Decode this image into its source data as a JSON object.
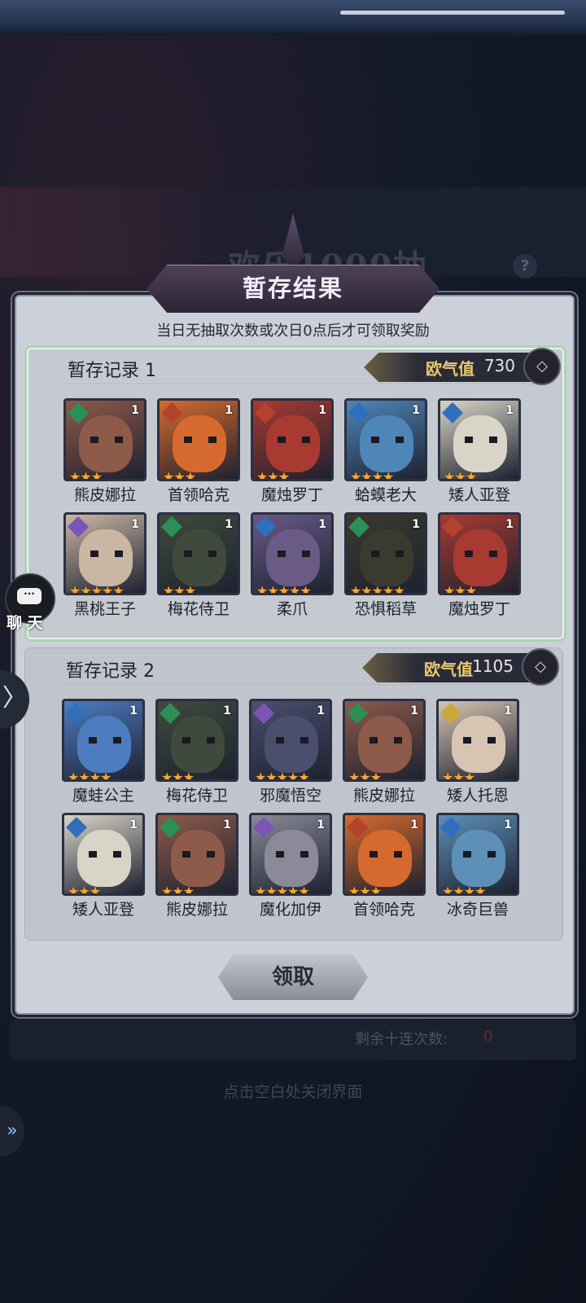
{
  "background": {
    "banner_text": "欢乐1000抽",
    "help_icon": "?"
  },
  "dialog": {
    "title": "暂存结果",
    "notice": "当日无抽取次数或次日0点后才可领取奖励",
    "claim_label": "领取"
  },
  "records": [
    {
      "title": "暂存记录 1",
      "luck_label": "欧气值",
      "luck_value": "730",
      "heroes": [
        {
          "name": "熊皮娜拉",
          "element": "green",
          "count": "1",
          "stars": "★★★",
          "color": "#8e5a4a"
        },
        {
          "name": "首领哈克",
          "element": "red",
          "count": "1",
          "stars": "★★★",
          "color": "#d66a2e"
        },
        {
          "name": "魔烛罗丁",
          "element": "red",
          "count": "1",
          "stars": "★★★",
          "color": "#a83a32"
        },
        {
          "name": "蛤蟆老大",
          "element": "blue",
          "count": "1",
          "stars": "★★★★",
          "color": "#4f86b8"
        },
        {
          "name": "矮人亚登",
          "element": "blue",
          "count": "1",
          "stars": "★★★",
          "color": "#d9d4c8"
        },
        {
          "name": "黑桃王子",
          "element": "purple",
          "count": "1",
          "stars": "★★★★★",
          "color": "#c9b7a4"
        },
        {
          "name": "梅花侍卫",
          "element": "green",
          "count": "1",
          "stars": "★★★",
          "color": "#3f4a3c"
        },
        {
          "name": "柔爪",
          "element": "blue",
          "count": "1",
          "stars": "★★★★★",
          "color": "#6a5a86"
        },
        {
          "name": "恐惧稻草",
          "element": "green",
          "count": "1",
          "stars": "★★★★★",
          "color": "#3a3a2e"
        },
        {
          "name": "魔烛罗丁",
          "element": "red",
          "count": "1",
          "stars": "★★★",
          "color": "#a83a32"
        }
      ]
    },
    {
      "title": "暂存记录 2",
      "luck_label": "欧气值",
      "luck_value": "1105",
      "heroes": [
        {
          "name": "魔蛙公主",
          "element": "blue",
          "count": "1",
          "stars": "★★★★",
          "color": "#4d7cc0"
        },
        {
          "name": "梅花侍卫",
          "element": "green",
          "count": "1",
          "stars": "★★★",
          "color": "#3f4a3c"
        },
        {
          "name": "邪魔悟空",
          "element": "purple",
          "count": "1",
          "stars": "★★★★★",
          "color": "#4c4e6e"
        },
        {
          "name": "熊皮娜拉",
          "element": "green",
          "count": "1",
          "stars": "★★★",
          "color": "#8e5a4a"
        },
        {
          "name": "矮人托恩",
          "element": "gold",
          "count": "1",
          "stars": "★★★",
          "color": "#d8c4b2"
        },
        {
          "name": "矮人亚登",
          "element": "blue",
          "count": "1",
          "stars": "★★★",
          "color": "#d9d4c8"
        },
        {
          "name": "熊皮娜拉",
          "element": "green",
          "count": "1",
          "stars": "★★★",
          "color": "#8e5a4a"
        },
        {
          "name": "魔化加伊",
          "element": "purple",
          "count": "1",
          "stars": "★★★★★",
          "color": "#8a8a98"
        },
        {
          "name": "首领哈克",
          "element": "red",
          "count": "1",
          "stars": "★★★",
          "color": "#d66a2e"
        },
        {
          "name": "冰奇巨兽",
          "element": "blue",
          "count": "1",
          "stars": "★★★★",
          "color": "#5d8fb8"
        }
      ]
    }
  ],
  "footer": {
    "remain_label": "剩余十连次数:",
    "remain_value": "0",
    "close_hint": "点击空白处关闭界面"
  },
  "side": {
    "chat_icon": "···",
    "chat_label": "聊 天",
    "arrow_icon": "〉",
    "double_arrow_icon": "»"
  }
}
